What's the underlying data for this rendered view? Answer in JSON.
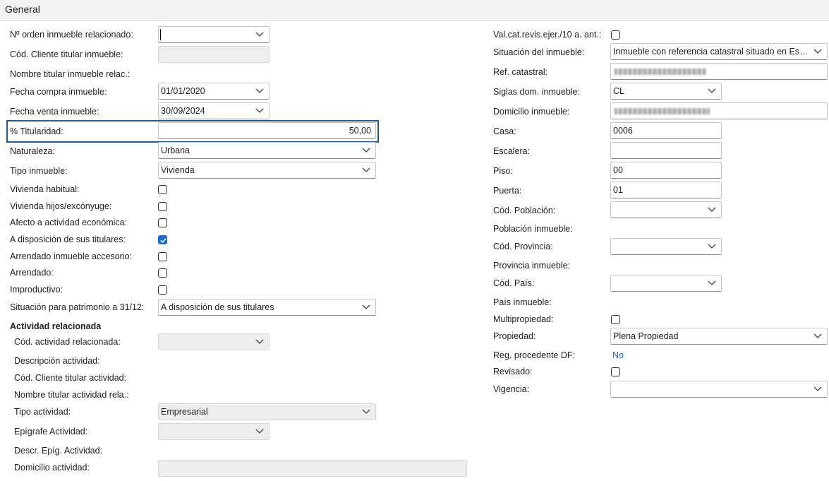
{
  "header": {
    "title": "General"
  },
  "left": {
    "orden_label": "Nº orden inmueble relacionado:",
    "orden_value": "",
    "cod_cliente_label": "Cód. Cliente titular inmueble:",
    "nombre_titular_label": "Nombre titular inmueble relac.:",
    "fecha_compra_label": "Fecha compra inmueble:",
    "fecha_compra_value": "01/01/2020",
    "fecha_venta_label": "Fecha venta inmueble:",
    "fecha_venta_value": "30/09/2024",
    "titularidad_label": "% Titularidad:",
    "titularidad_value": "50,00",
    "naturaleza_label": "Naturaleza:",
    "naturaleza_value": "Urbana",
    "tipo_inmueble_label": "Tipo inmueble:",
    "tipo_inmueble_value": "Vivienda",
    "checkboxes": [
      {
        "label": "Vivienda habitual:",
        "checked": false
      },
      {
        "label": "Vivienda hijos/excónyuge:",
        "checked": false
      },
      {
        "label": "Afecto a actividad económica:",
        "checked": false
      },
      {
        "label": "A disposición de sus titulares:",
        "checked": true
      },
      {
        "label": "Arrendado inmueble accesorio:",
        "checked": false
      },
      {
        "label": "Arrendado:",
        "checked": false
      },
      {
        "label": "Improductivo:",
        "checked": false
      }
    ],
    "situacion_patrimonio_label": "Situación para patrimonio a 31/12:",
    "situacion_patrimonio_value": "A disposición de sus titulares",
    "actividad_heading": "Actividad relacionada",
    "cod_actividad_label": "Cód. actividad relacionada:",
    "descripcion_actividad_label": "Descripción actividad:",
    "cod_cliente_actividad_label": "Cód. Cliente titular actividad:",
    "nombre_titular_actividad_label": "Nombre titular actividad rela.:",
    "tipo_actividad_label": "Tipo actividad:",
    "tipo_actividad_value": "Empresarial",
    "epigrafe_label": "Epígrafe Actividad:",
    "descr_epig_label": "Descr. Epíg. Actividad:",
    "domicilio_actividad_label": "Domicilio actividad:"
  },
  "right": {
    "valcat_label": "Val.cat.revis.ejer./10 a. ant.:",
    "situacion_label": "Situación del inmueble:",
    "situacion_value": "Inmueble con referencia catastral situado en Esp...",
    "ref_catastral_label": "Ref. catastral:",
    "siglas_label": "Siglas dom. inmueble:",
    "siglas_value": "CL",
    "domicilio_label": "Domicilio inmueble:",
    "casa_label": "Casa:",
    "casa_value": "0006",
    "escalera_label": "Escalera:",
    "escalera_value": "",
    "piso_label": "Piso:",
    "piso_value": "00",
    "puerta_label": "Puerta:",
    "puerta_value": "01",
    "cod_poblacion_label": "Cód. Población:",
    "poblacion_label": "Población inmueble:",
    "cod_provincia_label": "Cód. Provincia:",
    "provincia_label": "Provincia inmueble:",
    "cod_pais_label": "Cód. País:",
    "pais_label": "País inmueble:",
    "multipropiedad_label": "Multipropiedad:",
    "propiedad_label": "Propiedad:",
    "propiedad_value": "Plena Propiedad",
    "reg_procedente_label": "Reg. procedente DF:",
    "reg_procedente_value": "No",
    "revisado_label": "Revisado:",
    "vigencia_label": "Vigencia:",
    "vigencia_value": ""
  },
  "icons": {
    "dropdown": "chevron-down-icon",
    "checkmark": "check-icon"
  },
  "colors": {
    "accent": "#1a6dcc",
    "highlight_border": "#1b5d8f"
  }
}
